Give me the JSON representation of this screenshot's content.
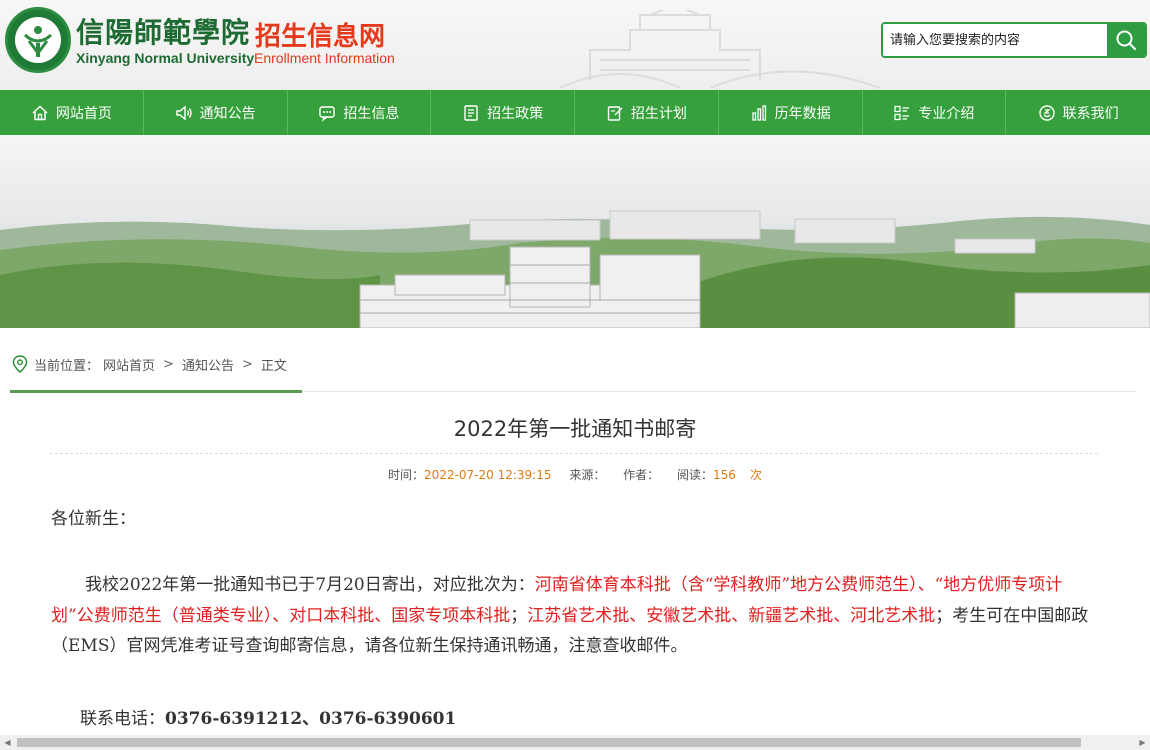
{
  "header": {
    "logo_cn": "信陽師範學院",
    "logo_en": "Xinyang Normal University",
    "site_cn": "招生信息网",
    "site_en": "Enrollment Information",
    "search_placeholder": "请输入您要搜索的内容",
    "search_icon": "magnifier-icon"
  },
  "nav": {
    "items": [
      {
        "label": "网站首页",
        "icon": "home-icon"
      },
      {
        "label": "通知公告",
        "icon": "speaker-icon"
      },
      {
        "label": "招生信息",
        "icon": "chat-icon"
      },
      {
        "label": "招生政策",
        "icon": "document-icon"
      },
      {
        "label": "招生计划",
        "icon": "edit-icon"
      },
      {
        "label": "历年数据",
        "icon": "bar-chart-icon"
      },
      {
        "label": "专业介绍",
        "icon": "list-icon"
      },
      {
        "label": "联系我们",
        "icon": "contact-icon"
      }
    ]
  },
  "breadcrumb": {
    "prefix": "当前位置：",
    "items": [
      "网站首页",
      "通知公告",
      "正文"
    ],
    "separator": ">"
  },
  "article": {
    "title": "2022年第一批通知书邮寄",
    "meta": {
      "time_label": "时间：",
      "time_value": "2022-07-20 12:39:15",
      "source_label": "来源：",
      "author_label": "作者：",
      "views_label": "阅读：",
      "views_value": "156",
      "views_unit": "次"
    },
    "greeting": "各位新生：",
    "paragraph": {
      "intro": "我校2022年第一批通知书已于7月20日寄出，对应批次为：",
      "highlight1": "河南省体育本科批（含“学科教师”地方公费师范生）、“地方优师专项计划”公费师范生（普通类专业）、对口本科批、国家专项本科批",
      "sep": "；",
      "highlight2": "江苏省艺术批、安徽艺术批、新疆艺术批、河北艺术批",
      "outro": "；考生可在中国邮政（EMS）官网凭准考证号查询邮寄信息，请各位新生保持通讯畅通，注意查收邮件。"
    },
    "contact_label": "联系电话：",
    "contact_value": "0376-6391212、0376-6390601"
  },
  "colors": {
    "nav_green": "#36a13c",
    "brand_green": "#1d6b32",
    "brand_red": "#e4391b",
    "highlight_red": "#e02020",
    "meta_orange": "#e07a13"
  }
}
